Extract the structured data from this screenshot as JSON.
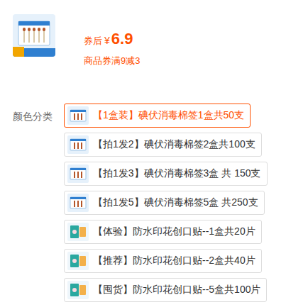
{
  "price": {
    "prefix": "券后",
    "currency": "¥",
    "amount": "6.9"
  },
  "coupon": "商品券满9减3",
  "options_label": "颜色分类",
  "options": [
    {
      "label": "【1盒装】碘伏消毒棉签1盒共50支",
      "selected": true,
      "kind": "swab"
    },
    {
      "label": "【拍1发2】碘伏消毒棉签2盒共100支",
      "selected": false,
      "kind": "swab"
    },
    {
      "label": "【拍1发3】碘伏消毒棉签3盒 共 150支",
      "selected": false,
      "kind": "swab"
    },
    {
      "label": "【拍1发5】碘伏消毒棉签5盒 共250支",
      "selected": false,
      "kind": "swab"
    },
    {
      "label": "【体验】防水印花创口贴--1盒共20片",
      "selected": false,
      "kind": "bandage"
    },
    {
      "label": "【推荐】防水印花创口贴--2盒共40片",
      "selected": false,
      "kind": "bandage"
    },
    {
      "label": "【囤货】防水印花创口贴--5盒共100片",
      "selected": false,
      "kind": "bandage"
    }
  ]
}
